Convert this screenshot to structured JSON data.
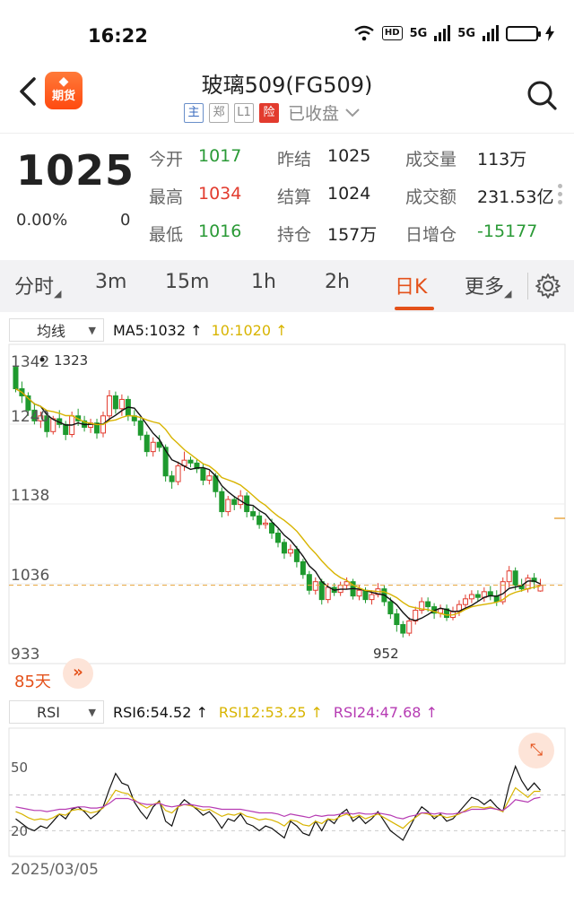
{
  "status": {
    "time": "16:22",
    "hd": "HD",
    "net1": "5G",
    "net2": "5G"
  },
  "header": {
    "title": "玻璃509(FG509)",
    "logo_text": "期货",
    "chips": [
      "主",
      "郑",
      "L1",
      "险"
    ],
    "market_status": "已收盘"
  },
  "quote": {
    "last": "1025",
    "change_pct": "0.00%",
    "change": "0",
    "fields": [
      {
        "label": "今开",
        "value": "1017",
        "color": "green"
      },
      {
        "label": "昨结",
        "value": "1025",
        "color": "normal"
      },
      {
        "label": "成交量",
        "value": "113万",
        "color": "normal"
      },
      {
        "label": "最高",
        "value": "1034",
        "color": "red"
      },
      {
        "label": "结算",
        "value": "1024",
        "color": "normal"
      },
      {
        "label": "成交额",
        "value": "231.53亿",
        "color": "normal"
      },
      {
        "label": "最低",
        "value": "1016",
        "color": "green"
      },
      {
        "label": "持仓",
        "value": "157万",
        "color": "normal"
      },
      {
        "label": "日增仓",
        "value": "-15177",
        "color": "green"
      }
    ]
  },
  "tabs": [
    "分时",
    "3m",
    "15m",
    "1h",
    "2h",
    "日K",
    "更多"
  ],
  "active_tab": "日K",
  "main_indicator": {
    "select": "均线",
    "ma5": "MA5:1032",
    "ma10": "10:1020",
    "arrow": "↑"
  },
  "sub_indicator": {
    "select": "RSI",
    "rsi6": "RSI6:54.52",
    "rsi12": "RSI12:53.25",
    "rsi24": "RSI24:47.68",
    "arrow": "↑"
  },
  "colors": {
    "up": "#e23b2e",
    "down": "#1e9a2e",
    "accent": "#e4511a",
    "ma5": "#111111",
    "ma10": "#d8b400",
    "rsi24": "#b63bb3"
  },
  "chart_data": [
    {
      "type": "candlestick",
      "y_ticks": [
        "1342",
        "1240",
        "1138",
        "1036",
        "933"
      ],
      "ylim": [
        933,
        1342
      ],
      "period_label": "85天",
      "annotations": {
        "high": "1323",
        "low": "952"
      },
      "reference_price": 1025,
      "candles": [
        [
          1330,
          1300,
          1335,
          1295
        ],
        [
          1300,
          1290,
          1310,
          1280
        ],
        [
          1290,
          1270,
          1295,
          1262
        ],
        [
          1270,
          1255,
          1280,
          1250
        ],
        [
          1255,
          1262,
          1268,
          1245
        ],
        [
          1262,
          1240,
          1268,
          1232
        ],
        [
          1240,
          1258,
          1262,
          1236
        ],
        [
          1258,
          1250,
          1270,
          1245
        ],
        [
          1250,
          1236,
          1255,
          1228
        ],
        [
          1236,
          1262,
          1268,
          1232
        ],
        [
          1262,
          1255,
          1272,
          1248
        ],
        [
          1255,
          1246,
          1262,
          1240
        ],
        [
          1246,
          1252,
          1258,
          1238
        ],
        [
          1252,
          1238,
          1258,
          1230
        ],
        [
          1238,
          1262,
          1268,
          1232
        ],
        [
          1262,
          1290,
          1298,
          1255
        ],
        [
          1290,
          1272,
          1296,
          1265
        ],
        [
          1272,
          1285,
          1292,
          1262
        ],
        [
          1285,
          1262,
          1290,
          1255
        ],
        [
          1262,
          1255,
          1270,
          1248
        ],
        [
          1255,
          1235,
          1260,
          1228
        ],
        [
          1235,
          1212,
          1240,
          1205
        ],
        [
          1212,
          1225,
          1232,
          1205
        ],
        [
          1225,
          1218,
          1235,
          1212
        ],
        [
          1218,
          1178,
          1222,
          1170
        ],
        [
          1178,
          1170,
          1185,
          1160
        ],
        [
          1170,
          1192,
          1198,
          1165
        ],
        [
          1192,
          1200,
          1212,
          1185
        ],
        [
          1200,
          1196,
          1205,
          1190
        ],
        [
          1196,
          1188,
          1202,
          1182
        ],
        [
          1188,
          1172,
          1195,
          1165
        ],
        [
          1172,
          1178,
          1185,
          1166
        ],
        [
          1178,
          1156,
          1182,
          1148
        ],
        [
          1156,
          1128,
          1162,
          1120
        ],
        [
          1128,
          1145,
          1150,
          1122
        ],
        [
          1145,
          1138,
          1150,
          1130
        ],
        [
          1138,
          1150,
          1158,
          1132
        ],
        [
          1150,
          1128,
          1155,
          1120
        ],
        [
          1128,
          1122,
          1135,
          1116
        ],
        [
          1122,
          1110,
          1128,
          1104
        ],
        [
          1110,
          1112,
          1118,
          1104
        ],
        [
          1112,
          1098,
          1118,
          1090
        ],
        [
          1098,
          1085,
          1104,
          1078
        ],
        [
          1085,
          1070,
          1090,
          1062
        ],
        [
          1070,
          1075,
          1082,
          1065
        ],
        [
          1075,
          1058,
          1080,
          1050
        ],
        [
          1058,
          1040,
          1062,
          1034
        ],
        [
          1040,
          1018,
          1045,
          1012
        ],
        [
          1018,
          1030,
          1036,
          1012
        ],
        [
          1030,
          1005,
          1034,
          998
        ],
        [
          1005,
          1022,
          1028,
          1000
        ],
        [
          1022,
          1015,
          1028,
          1010
        ],
        [
          1015,
          1025,
          1030,
          1010
        ],
        [
          1025,
          1030,
          1036,
          1020
        ],
        [
          1030,
          1010,
          1034,
          1005
        ],
        [
          1010,
          1018,
          1025,
          1004
        ],
        [
          1018,
          1005,
          1022,
          1000
        ],
        [
          1005,
          1012,
          1018,
          998
        ],
        [
          1012,
          1020,
          1028,
          1008
        ],
        [
          1020,
          1002,
          1025,
          996
        ],
        [
          1002,
          985,
          1008,
          978
        ],
        [
          985,
          970,
          992,
          960
        ],
        [
          970,
          958,
          975,
          952
        ],
        [
          958,
          975,
          980,
          954
        ],
        [
          975,
          990,
          995,
          970
        ],
        [
          990,
          1002,
          1008,
          985
        ],
        [
          1002,
          995,
          1008,
          988
        ],
        [
          995,
          986,
          1000,
          978
        ],
        [
          986,
          992,
          998,
          980
        ],
        [
          992,
          980,
          998,
          975
        ],
        [
          980,
          988,
          995,
          976
        ],
        [
          988,
          998,
          1004,
          982
        ],
        [
          998,
          1006,
          1012,
          992
        ],
        [
          1006,
          1012,
          1018,
          1000
        ],
        [
          1012,
          1008,
          1018,
          1002
        ],
        [
          1008,
          1016,
          1022,
          1002
        ],
        [
          1016,
          1010,
          1024,
          1004
        ],
        [
          1010,
          1002,
          1018,
          996
        ],
        [
          1002,
          1030,
          1036,
          998
        ],
        [
          1030,
          1045,
          1052,
          1022
        ],
        [
          1045,
          1025,
          1050,
          1018
        ],
        [
          1025,
          1020,
          1034,
          1016
        ],
        [
          1020,
          1035,
          1040,
          1015
        ],
        [
          1035,
          1030,
          1042,
          1020
        ],
        [
          1017,
          1025,
          1034,
          1016
        ]
      ]
    },
    {
      "type": "line",
      "y_ticks": [
        "50",
        "20"
      ],
      "ylim": [
        0,
        100
      ],
      "start_date": "2025/03/05",
      "series": [
        {
          "name": "RSI6",
          "values": [
            30,
            26,
            22,
            20,
            24,
            22,
            28,
            34,
            30,
            38,
            40,
            36,
            30,
            34,
            40,
            55,
            68,
            60,
            58,
            44,
            36,
            30,
            40,
            45,
            28,
            24,
            40,
            46,
            42,
            38,
            33,
            36,
            30,
            22,
            30,
            28,
            34,
            26,
            24,
            20,
            24,
            22,
            18,
            14,
            28,
            24,
            18,
            16,
            28,
            20,
            30,
            26,
            34,
            38,
            28,
            32,
            26,
            30,
            36,
            28,
            20,
            16,
            12,
            22,
            32,
            40,
            36,
            30,
            34,
            28,
            30,
            36,
            42,
            48,
            46,
            42,
            46,
            40,
            36,
            58,
            74,
            62,
            54,
            60,
            54
          ]
        },
        {
          "name": "RSI12",
          "values": [
            36,
            34,
            31,
            29,
            30,
            29,
            31,
            34,
            33,
            37,
            38,
            37,
            35,
            36,
            39,
            46,
            54,
            52,
            51,
            46,
            42,
            39,
            42,
            44,
            37,
            35,
            40,
            42,
            41,
            39,
            37,
            38,
            35,
            32,
            34,
            33,
            35,
            32,
            31,
            29,
            30,
            29,
            27,
            24,
            29,
            28,
            25,
            24,
            28,
            26,
            30,
            29,
            32,
            34,
            31,
            33,
            30,
            32,
            34,
            31,
            28,
            25,
            22,
            27,
            31,
            35,
            34,
            32,
            33,
            31,
            32,
            34,
            37,
            40,
            40,
            39,
            40,
            38,
            36,
            46,
            56,
            52,
            48,
            53,
            53
          ]
        },
        {
          "name": "RSI24",
          "values": [
            40,
            39,
            38,
            37,
            37,
            36,
            37,
            38,
            38,
            39,
            40,
            40,
            39,
            39,
            40,
            43,
            47,
            47,
            47,
            45,
            43,
            42,
            42,
            43,
            41,
            40,
            41,
            42,
            42,
            41,
            40,
            40,
            39,
            38,
            38,
            38,
            38,
            37,
            36,
            35,
            35,
            35,
            34,
            32,
            34,
            33,
            32,
            31,
            33,
            32,
            33,
            33,
            34,
            35,
            34,
            35,
            34,
            34,
            35,
            34,
            33,
            31,
            30,
            32,
            33,
            35,
            35,
            34,
            35,
            34,
            34,
            35,
            36,
            38,
            38,
            38,
            39,
            38,
            37,
            41,
            46,
            45,
            44,
            47,
            48
          ]
        }
      ]
    }
  ]
}
